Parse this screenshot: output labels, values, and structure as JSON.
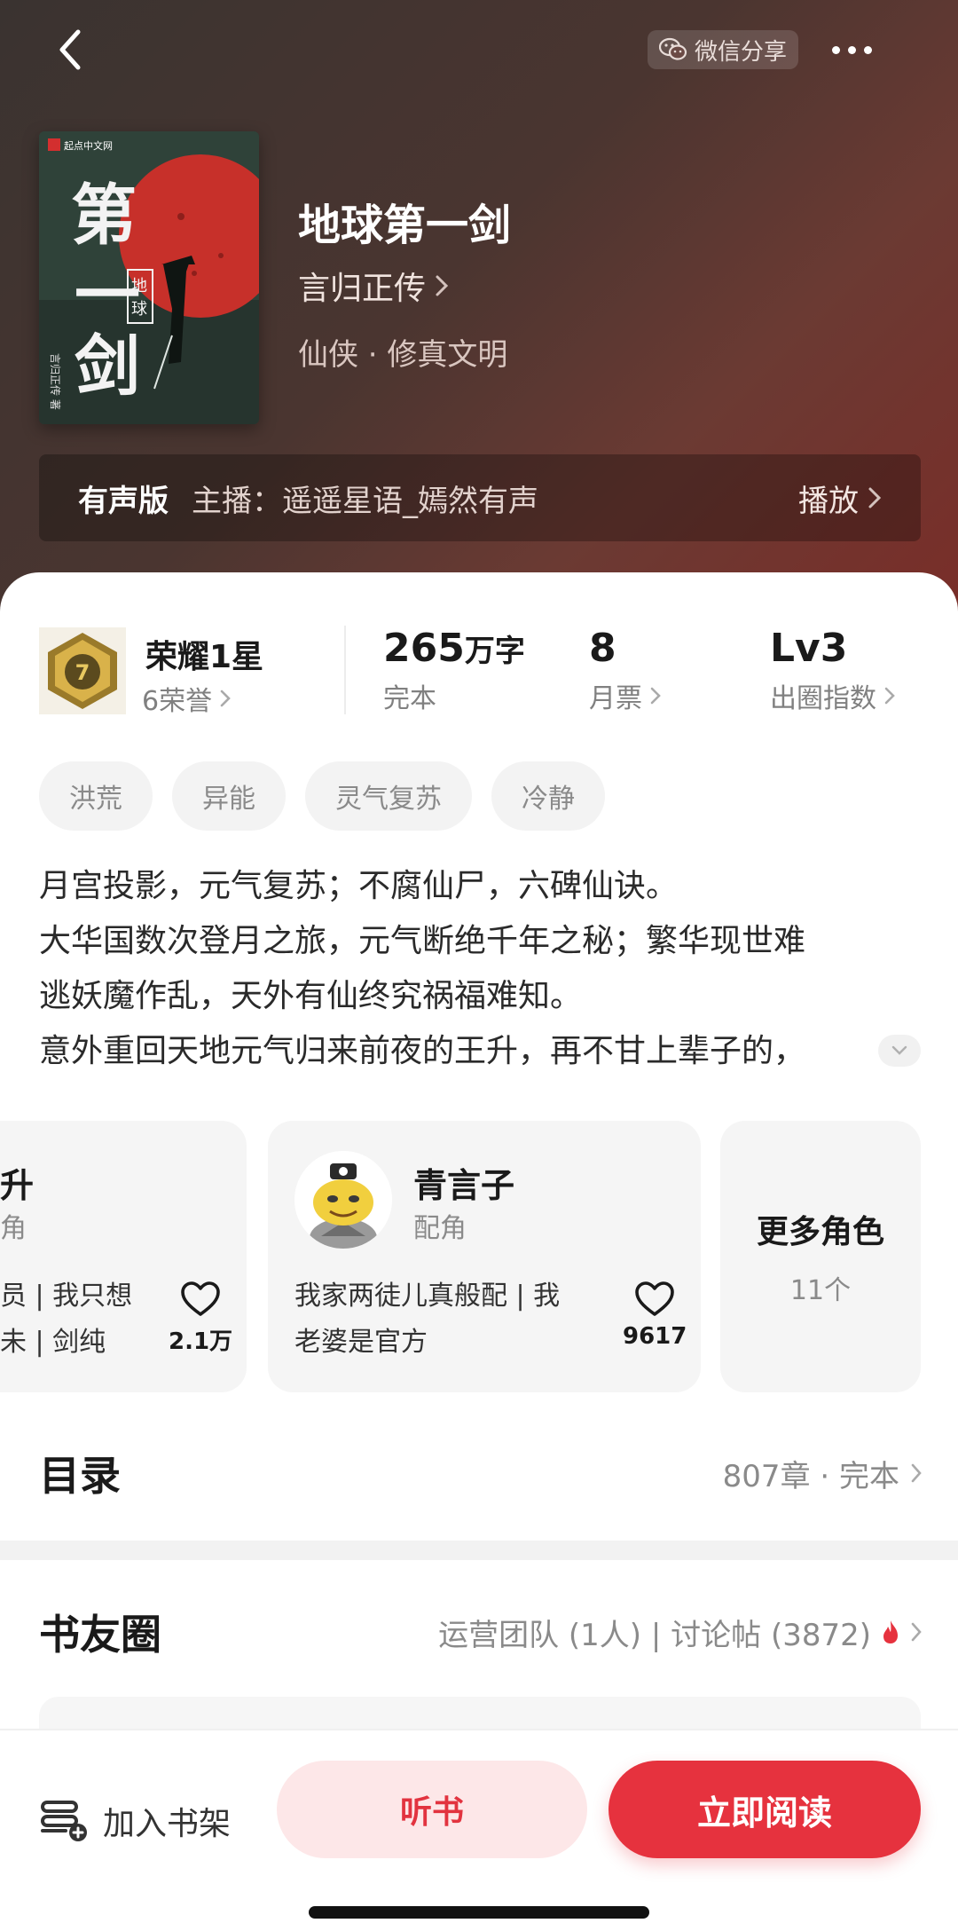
{
  "header": {
    "share_label": "微信分享",
    "cover_publisher": "起点中文网"
  },
  "book": {
    "title": "地球第一剑",
    "author": "言归正传",
    "genre": "仙侠 · 修真文明",
    "cover_title_big": "第一剑",
    "cover_title_tag": "地球",
    "cover_author": "言归正传 ◎ 著"
  },
  "audio": {
    "badge": "有声版",
    "host": "主播：遥遥星语_嫣然有声",
    "play_label": "播放"
  },
  "stats": {
    "honor_name": "荣耀1星",
    "honor_count": "6荣誉",
    "words_value": "265",
    "words_unit": "万字",
    "words_label": "完本",
    "tickets_value": "8",
    "tickets_label": "月票",
    "level_value": "Lv3",
    "level_label": "出圈指数"
  },
  "tags": [
    "洪荒",
    "异能",
    "灵气复苏",
    "冷静"
  ],
  "intro": {
    "lines": [
      "月宫投影，元气复苏；不腐仙尸，六碑仙诀。",
      "大华国数次登月之旅，元气断绝千年之秘；繁华现世难",
      "逃妖魔作乱，天外有仙终究祸福难知。",
      "意外重回天地元气归来前夜的王升，再不甘上辈子的，"
    ]
  },
  "roles": [
    {
      "name": "升",
      "type": "角",
      "desc_line1": "员 | 我只想",
      "desc_line2": "未 | 剑纯",
      "likes": "2.1万"
    },
    {
      "name": "青言子",
      "type": "配角",
      "desc_line1": "我家两徒儿真般配 | 我",
      "desc_line2": "老婆是官方",
      "likes": "9617"
    }
  ],
  "more_roles": {
    "title": "更多角色",
    "count": "11个"
  },
  "toc": {
    "title": "目录",
    "meta": "807章 · 完本"
  },
  "circle": {
    "title": "书友圈",
    "meta": "运营团队 (1人) | 讨论帖 (3872)"
  },
  "bottom": {
    "add_shelf": "加入书架",
    "listen": "听书",
    "read": "立即阅读"
  },
  "colors": {
    "accent": "#e6323e",
    "accent_soft": "#fde7e8",
    "hero_dark": "#3a3330",
    "hero_red": "#7a2d28"
  }
}
